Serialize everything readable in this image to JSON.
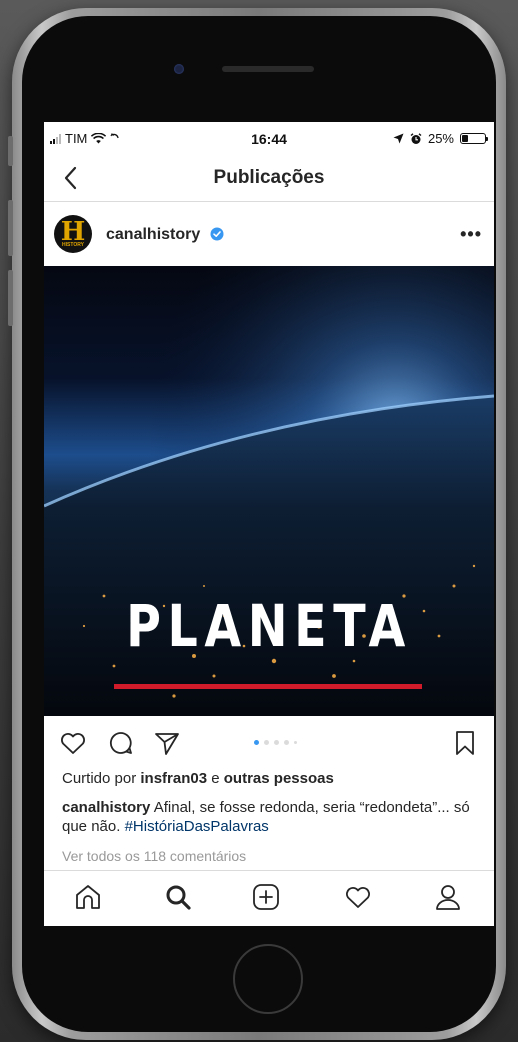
{
  "status_bar": {
    "carrier": "TIM",
    "time": "16:44",
    "battery_text": "25%",
    "battery_level": 0.25
  },
  "nav": {
    "title": "Publicações",
    "back_icon": "chevron-left-icon"
  },
  "post": {
    "username": "canalhistory",
    "verified": true,
    "avatar_text": "H",
    "avatar_sub": "HISTORY",
    "more_label": "•••",
    "image_title": "PLANETA",
    "carousel": {
      "count": 5,
      "active_index": 0
    },
    "likes": {
      "prefix": "Curtido por",
      "user": "insfran03",
      "connector": "e",
      "others": "outras pessoas"
    },
    "caption": {
      "username": "canalhistory",
      "text": "Afinal, se fosse redonda, seria “redondeta”... só que não.",
      "hashtag": "#HistóriaDasPalavras"
    },
    "comments_link": "Ver todos os 118 comentários"
  },
  "tabs": [
    {
      "name": "home-icon"
    },
    {
      "name": "search-icon"
    },
    {
      "name": "add-post-icon"
    },
    {
      "name": "heart-icon"
    },
    {
      "name": "profile-icon"
    }
  ],
  "colors": {
    "accent_blue": "#3897f0",
    "title_underline": "#d11a2a",
    "text": "#262626",
    "muted": "#999999"
  }
}
